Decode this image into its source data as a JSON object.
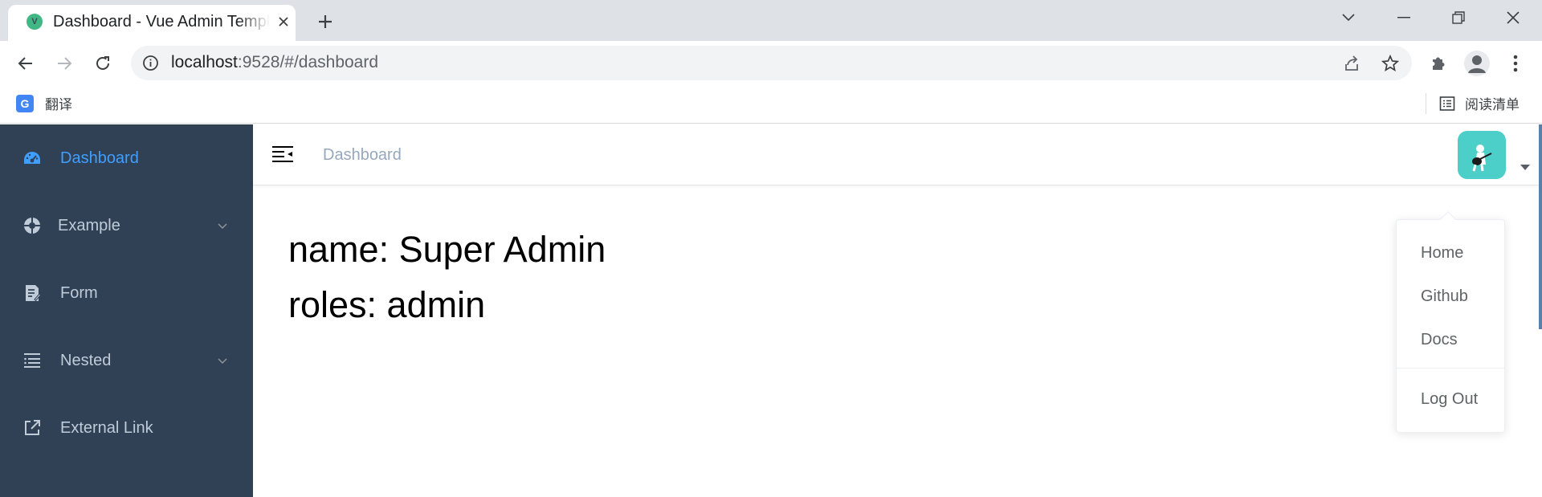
{
  "browser": {
    "tab_title": "Dashboard - Vue Admin Template",
    "favicon_letter": "V",
    "url_host": "localhost",
    "url_rest": ":9528/#/dashboard",
    "bookmark_label": "翻译",
    "bookmark_icon_letter": "G",
    "reading_list_label": "阅读清单"
  },
  "sidebar": {
    "items": [
      {
        "label": "Dashboard",
        "icon": "dashboard-icon",
        "active": true
      },
      {
        "label": "Example",
        "icon": "example-icon",
        "has_submenu": true
      },
      {
        "label": "Form",
        "icon": "form-icon"
      },
      {
        "label": "Nested",
        "icon": "nested-icon",
        "has_submenu": true
      },
      {
        "label": "External Link",
        "icon": "external-link-icon"
      }
    ]
  },
  "navbar": {
    "breadcrumb": "Dashboard"
  },
  "dashboard": {
    "name_line": "name: Super Admin",
    "roles_line": "roles: admin"
  },
  "user_dropdown": {
    "items": [
      "Home",
      "Github",
      "Docs",
      "Log Out"
    ]
  },
  "colors": {
    "sidebar_bg": "#304156",
    "sidebar_text": "#bfcbd9",
    "active_text": "#409eff",
    "breadcrumb_text": "#97a8be",
    "avatar_bg": "#4ccfc9"
  }
}
